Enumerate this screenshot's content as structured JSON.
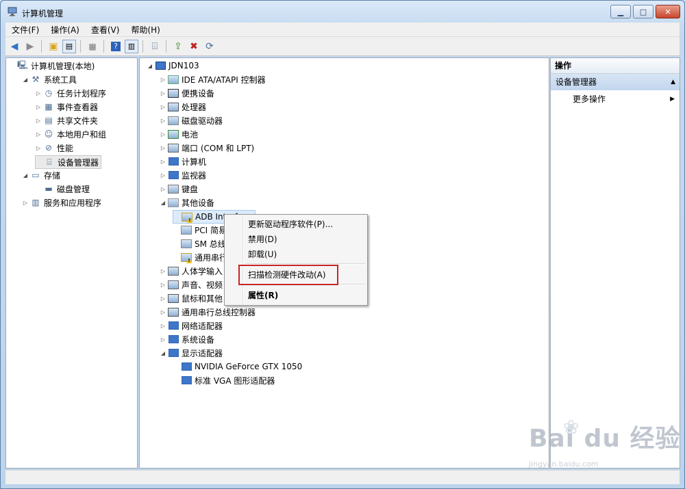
{
  "window": {
    "title": "计算机管理"
  },
  "menu": [
    "文件(F)",
    "操作(A)",
    "查看(V)",
    "帮助(H)"
  ],
  "left_tree": [
    {
      "label": "计算机管理(本地)",
      "expander": "",
      "depth": 0,
      "icon": "computer-management-icon"
    },
    {
      "label": "系统工具",
      "expander": "expanded",
      "depth": 1,
      "icon": "system-tools-icon"
    },
    {
      "label": "任务计划程序",
      "expander": "collapsed",
      "depth": 2,
      "icon": "task-scheduler-icon"
    },
    {
      "label": "事件查看器",
      "expander": "collapsed",
      "depth": 2,
      "icon": "event-viewer-icon"
    },
    {
      "label": "共享文件夹",
      "expander": "collapsed",
      "depth": 2,
      "icon": "shared-folders-icon"
    },
    {
      "label": "本地用户和组",
      "expander": "collapsed",
      "depth": 2,
      "icon": "users-groups-icon"
    },
    {
      "label": "性能",
      "expander": "collapsed",
      "depth": 2,
      "icon": "performance-icon"
    },
    {
      "label": "设备管理器",
      "expander": "",
      "depth": 2,
      "icon": "device-manager-icon",
      "selected": true
    },
    {
      "label": "存储",
      "expander": "expanded",
      "depth": 1,
      "icon": "storage-icon"
    },
    {
      "label": "磁盘管理",
      "expander": "",
      "depth": 2,
      "icon": "disk-management-icon"
    },
    {
      "label": "服务和应用程序",
      "expander": "collapsed",
      "depth": 1,
      "icon": "services-apps-icon"
    }
  ],
  "device_tree": {
    "root": "JDN103",
    "items": [
      {
        "label": "IDE ATA/ATAPI 控制器",
        "expander": "collapsed",
        "depth": 1,
        "icon": "ide-controller-icon"
      },
      {
        "label": "便携设备",
        "expander": "collapsed",
        "depth": 1,
        "icon": "portable-device-icon"
      },
      {
        "label": "处理器",
        "expander": "collapsed",
        "depth": 1,
        "icon": "processor-icon"
      },
      {
        "label": "磁盘驱动器",
        "expander": "collapsed",
        "depth": 1,
        "icon": "disk-drive-icon"
      },
      {
        "label": "电池",
        "expander": "collapsed",
        "depth": 1,
        "icon": "battery-icon"
      },
      {
        "label": "端口 (COM 和 LPT)",
        "expander": "collapsed",
        "depth": 1,
        "icon": "port-icon"
      },
      {
        "label": "计算机",
        "expander": "collapsed",
        "depth": 1,
        "icon": "computer-icon"
      },
      {
        "label": "监视器",
        "expander": "collapsed",
        "depth": 1,
        "icon": "monitor-icon"
      },
      {
        "label": "键盘",
        "expander": "collapsed",
        "depth": 1,
        "icon": "keyboard-icon"
      },
      {
        "label": "其他设备",
        "expander": "expanded",
        "depth": 1,
        "icon": "other-devices-icon"
      },
      {
        "label": "ADB Interface",
        "expander": "",
        "depth": 2,
        "icon": "warning-device-icon",
        "highlight": true
      },
      {
        "label": "PCI 简易",
        "expander": "",
        "depth": 2,
        "icon": "unknown-device-icon"
      },
      {
        "label": "SM 总线",
        "expander": "",
        "depth": 2,
        "icon": "unknown-device-icon"
      },
      {
        "label": "通用串行",
        "expander": "",
        "depth": 2,
        "icon": "warning-device-icon"
      },
      {
        "label": "人体学输入",
        "expander": "collapsed",
        "depth": 1,
        "icon": "hid-icon"
      },
      {
        "label": "声音、视频",
        "expander": "collapsed",
        "depth": 1,
        "icon": "sound-icon"
      },
      {
        "label": "鼠标和其他",
        "expander": "collapsed",
        "depth": 1,
        "icon": "mouse-icon"
      },
      {
        "label": "通用串行总线控制器",
        "expander": "collapsed",
        "depth": 1,
        "icon": "usb-icon"
      },
      {
        "label": "网络适配器",
        "expander": "collapsed",
        "depth": 1,
        "icon": "network-adapter-icon"
      },
      {
        "label": "系统设备",
        "expander": "collapsed",
        "depth": 1,
        "icon": "system-device-icon"
      },
      {
        "label": "显示适配器",
        "expander": "expanded",
        "depth": 1,
        "icon": "display-adapter-icon"
      },
      {
        "label": "NVIDIA GeForce GTX 1050",
        "expander": "",
        "depth": 2,
        "icon": "display-adapter-icon"
      },
      {
        "label": "标准 VGA 图形适配器",
        "expander": "",
        "depth": 2,
        "icon": "display-adapter-icon"
      }
    ]
  },
  "context_menu": {
    "update_driver": "更新驱动程序软件(P)...",
    "disable": "禁用(D)",
    "uninstall": "卸载(U)",
    "scan": "扫描检测硬件改动(A)",
    "properties": "属性(R)"
  },
  "actions": {
    "header": "操作",
    "group": "设备管理器",
    "more": "更多操作"
  },
  "watermark": {
    "main": "Bai du 经验",
    "url": "jingyan.baidu.com"
  }
}
